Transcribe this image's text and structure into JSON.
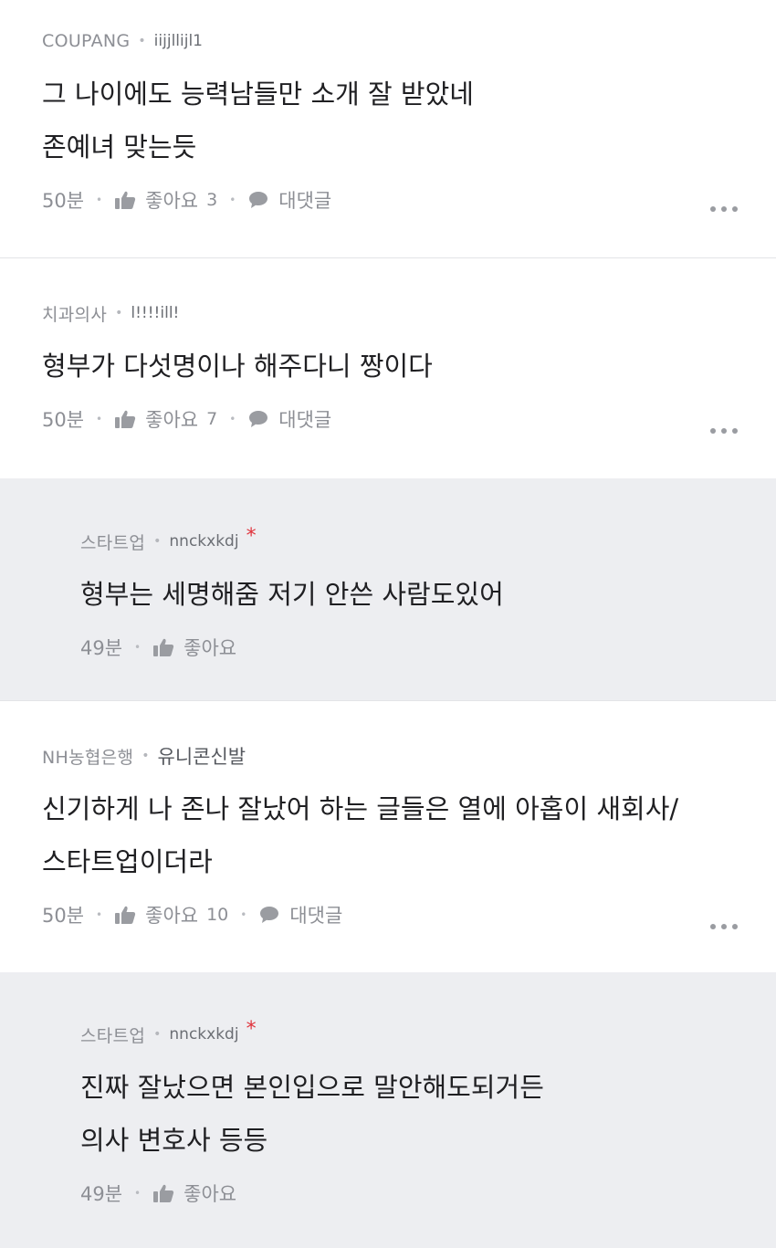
{
  "comments": [
    {
      "company": "COUPANG",
      "nickname": "iijjllijl1",
      "lines": [
        "그 나이에도 능력남들만 소개 잘 받았네",
        "존예녀 맞는듯"
      ],
      "time": "50분",
      "like_label": "좋아요",
      "like_count": "3",
      "reply_label": "대댓글"
    },
    {
      "company": "치과의사",
      "nickname": "l!!!!ill!",
      "lines": [
        "형부가 다섯명이나 해주다니 짱이다"
      ],
      "time": "50분",
      "like_label": "좋아요",
      "like_count": "7",
      "reply_label": "대댓글"
    },
    {
      "company": "스타트업",
      "nickname": "nnckxkdj",
      "author_mark": "*",
      "lines": [
        "형부는 세명해줌 저기 안쓴 사람도있어"
      ],
      "time": "49분",
      "like_label": "좋아요"
    },
    {
      "company": "NH농협은행",
      "nickname": "유니콘신발",
      "lines": [
        "신기하게 나 존나 잘났어 하는 글들은 열에 아홉이 새회사/",
        "스타트업이더라"
      ],
      "time": "50분",
      "like_label": "좋아요",
      "like_count": "10",
      "reply_label": "대댓글"
    },
    {
      "company": "스타트업",
      "nickname": "nnckxkdj",
      "author_mark": "*",
      "lines": [
        "진짜 잘났으면 본인입으로 말안해도되거든",
        "의사 변호사 등등"
      ],
      "time": "49분",
      "like_label": "좋아요"
    }
  ],
  "icons": {
    "like": "thumbs-up-icon",
    "reply": "speech-bubble-icon",
    "more": "more-dots-icon"
  },
  "colors": {
    "reply_background": "#edeef1",
    "author_mark": "#e0333c"
  }
}
